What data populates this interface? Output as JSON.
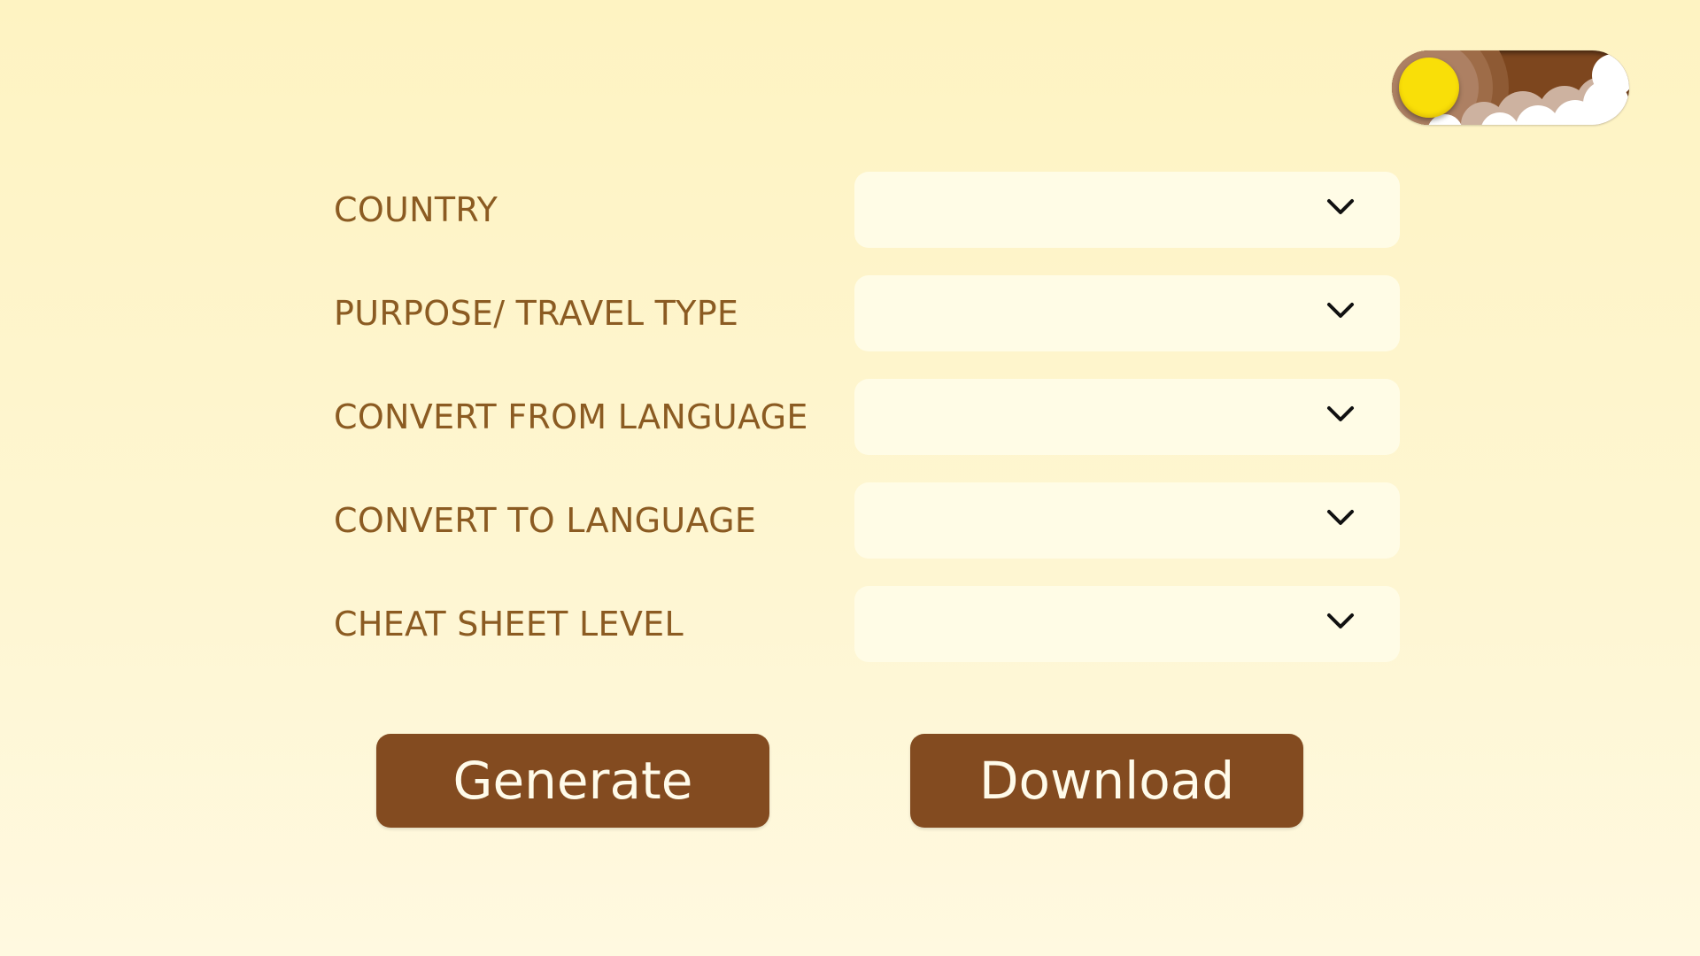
{
  "theme_toggle": {
    "state": "light",
    "knob_color": "#f9df08",
    "track_color": "#7d461e"
  },
  "form": {
    "fields": [
      {
        "label": "COUNTRY",
        "value": ""
      },
      {
        "label": "PURPOSE/ TRAVEL TYPE",
        "value": ""
      },
      {
        "label": "CONVERT FROM LANGUAGE",
        "value": ""
      },
      {
        "label": "CONVERT TO LANGUAGE",
        "value": ""
      },
      {
        "label": "CHEAT SHEET LEVEL",
        "value": ""
      }
    ]
  },
  "actions": {
    "generate_label": "Generate",
    "download_label": "Download"
  },
  "colors": {
    "label_text": "#8b5b22",
    "button_bg": "#834b20",
    "button_text": "#fffbea",
    "select_bg": "#fffce6"
  }
}
